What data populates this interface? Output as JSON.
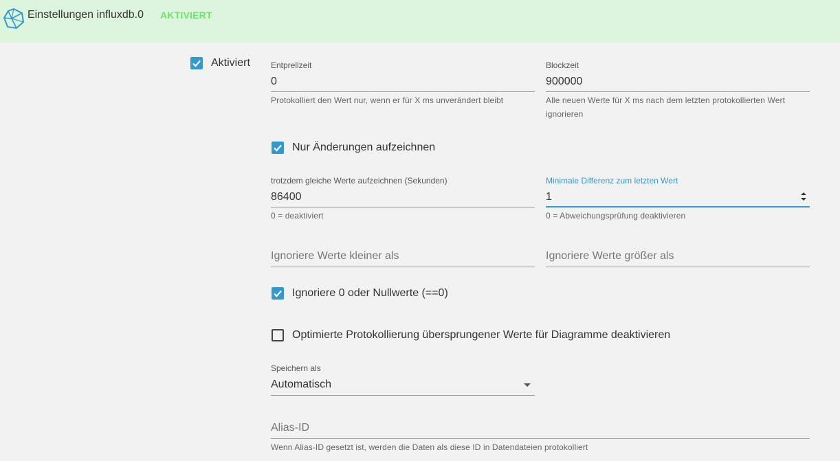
{
  "header": {
    "title": "Einstellungen influxdb.0",
    "status_badge": "AKTIVIERT",
    "logo_icon": "influxdb-logo-icon"
  },
  "enabled": {
    "label": "Aktiviert",
    "checked": true
  },
  "debounce": {
    "label": "Entprellzeit",
    "value": "0",
    "helper": "Protokolliert den Wert nur, wenn er für X ms unverändert bleibt"
  },
  "blocktime": {
    "label": "Blockzeit",
    "value": "900000",
    "helper": "Alle neuen Werte für X ms nach dem letzten protokollierten Wert ignorieren"
  },
  "changes_only": {
    "label": "Nur Änderungen aufzeichnen",
    "checked": true
  },
  "changes_relog": {
    "label": "trotzdem gleiche Werte aufzeichnen (Sekunden)",
    "value": "86400",
    "helper": "0 = deaktiviert"
  },
  "min_difference": {
    "label": "Minimale Differenz zum letzten Wert",
    "value": "1",
    "helper": "0 = Abweichungsprüfung deaktivieren"
  },
  "ignore_below": {
    "placeholder": "Ignoriere Werte kleiner als"
  },
  "ignore_above": {
    "placeholder": "Ignoriere Werte größer als"
  },
  "ignore_zero": {
    "label": "Ignoriere 0 oder Nullwerte (==0)",
    "checked": true
  },
  "disable_optimization": {
    "label": "Optimierte Protokollierung übersprungener Werte für Diagramme deaktivieren",
    "checked": false
  },
  "store_as": {
    "label": "Speichern als",
    "value": "Automatisch"
  },
  "alias": {
    "placeholder": "Alias-ID",
    "helper": "Wenn Alias-ID gesetzt ist, werden die Daten als diese ID in Datendateien protokolliert"
  },
  "colors": {
    "header_bg": "#dcf5dc",
    "badge": "#6ee46e",
    "accent": "#3399cc"
  }
}
